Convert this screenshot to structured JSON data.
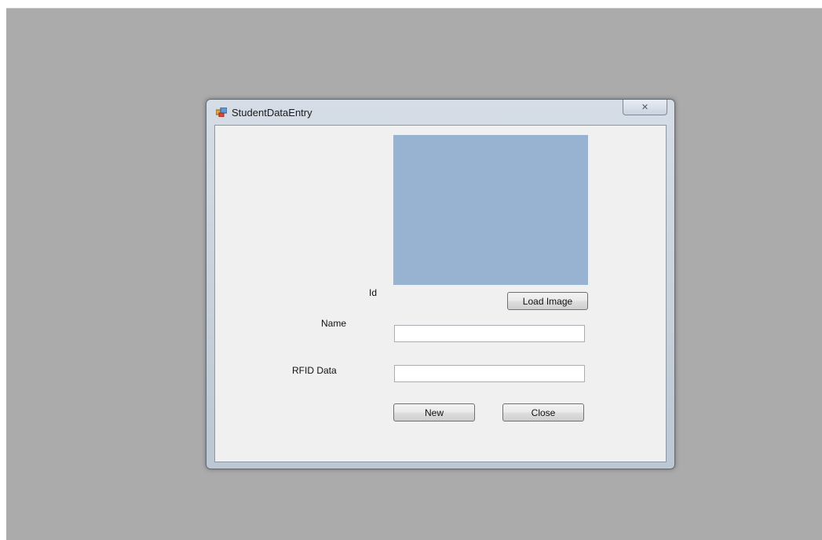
{
  "window": {
    "title": "StudentDataEntry",
    "close_symbol": "✕",
    "icon": "app-form-icon"
  },
  "form": {
    "id_label": "Id",
    "name_label": "Name",
    "rfid_label": "RFID Data",
    "name_value": "",
    "rfid_value": "",
    "load_image_label": "Load Image",
    "new_label": "New",
    "close_label": "Close",
    "picture_color": "#97b3d1"
  }
}
